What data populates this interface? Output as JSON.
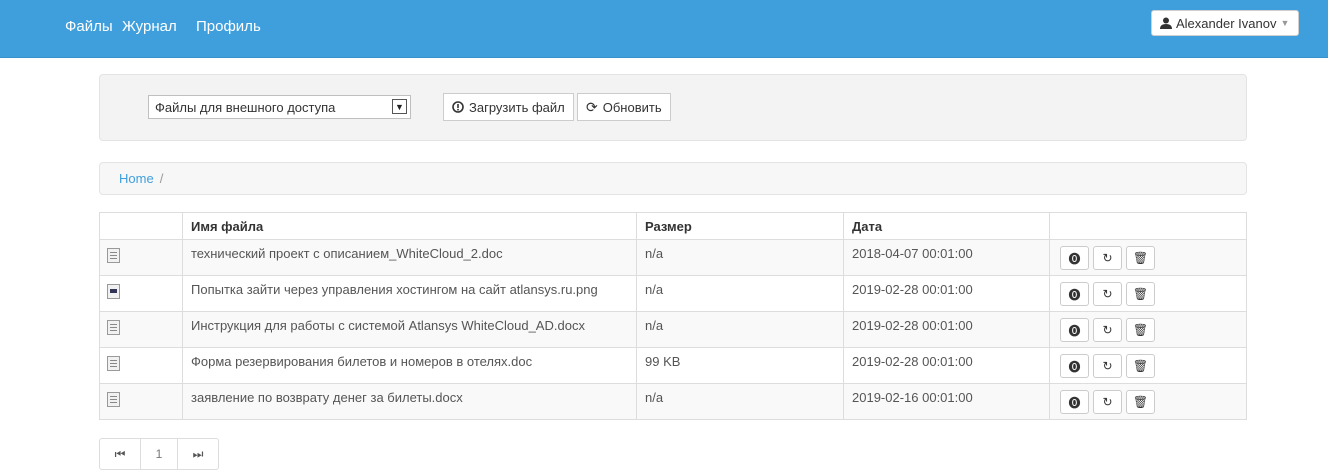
{
  "navbar": {
    "links": [
      "Файлы",
      "Журнал",
      "Профиль"
    ],
    "user": "Alexander Ivanov"
  },
  "toolbar": {
    "select_value": "Файлы для внешного доступа",
    "upload_label": "Загрузить файл",
    "refresh_label": "Обновить"
  },
  "breadcrumb": {
    "home": "Home",
    "separator": "/"
  },
  "table": {
    "headers": [
      "",
      "Имя файла",
      "Размер",
      "Дата",
      ""
    ],
    "rows": [
      {
        "type": "doc",
        "name": "технический проект с описанием_WhiteCloud_2.doc",
        "size": "n/a",
        "date": "2018-04-07 00:01:00"
      },
      {
        "type": "image",
        "name": "Попытка зайти через управления хостингом на сайт atlansys.ru.png",
        "size": "n/a",
        "date": "2019-02-28 00:01:00"
      },
      {
        "type": "doc",
        "name": "Инструкция для работы с системой Atlansys WhiteCloud_AD.docx",
        "size": "n/a",
        "date": "2019-02-28 00:01:00"
      },
      {
        "type": "doc",
        "name": "Форма резервирования билетов и номеров в отелях.doc",
        "size": "99 KB",
        "date": "2019-02-28 00:01:00"
      },
      {
        "type": "doc",
        "name": "заявление по возврату денег за билеты.docx",
        "size": "n/a",
        "date": "2019-02-16 00:01:00"
      }
    ]
  },
  "pagination": {
    "first_icon": "first-page-icon",
    "current_page": "1",
    "last_icon": "last-page-icon"
  },
  "colors": {
    "navbar": "#3f9fdd",
    "link": "#3f9fdd"
  }
}
